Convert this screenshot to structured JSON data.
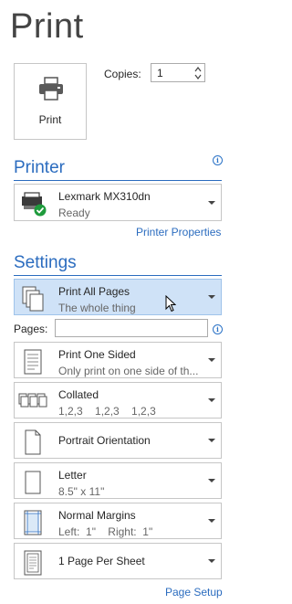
{
  "page": {
    "title": "Print"
  },
  "print_button": {
    "label": "Print",
    "icon": "printer-icon"
  },
  "copies": {
    "label": "Copies:",
    "value": "1"
  },
  "printer": {
    "heading": "Printer",
    "name": "Lexmark MX310dn",
    "status": "Ready",
    "properties_link": "Printer Properties",
    "info_symbol": "i"
  },
  "settings": {
    "heading": "Settings",
    "pages_label": "Pages:",
    "pages_value": "",
    "info_symbol": "i",
    "items": [
      {
        "title": "Print All Pages",
        "subtitle": "The whole thing",
        "icon": "pages-stack-icon"
      },
      {
        "title": "Print One Sided",
        "subtitle": "Only print on one side of th...",
        "icon": "one-sided-icon"
      },
      {
        "title": "Collated",
        "subtitle": "1,2,3    1,2,3    1,2,3",
        "icon": "collated-icon"
      },
      {
        "title": "Portrait Orientation",
        "subtitle": "",
        "icon": "portrait-icon"
      },
      {
        "title": "Letter",
        "subtitle": "8.5\" x 11\"",
        "icon": "paper-size-icon"
      },
      {
        "title": "Normal Margins",
        "subtitle": "Left:  1\"    Right:  1\"",
        "icon": "margins-icon"
      },
      {
        "title": "1 Page Per Sheet",
        "subtitle": "",
        "icon": "pages-per-sheet-icon"
      }
    ],
    "page_setup_link": "Page Setup"
  },
  "colors": {
    "accent": "#2b6cbf",
    "selected_bg": "#cfe2f7",
    "ready_green": "#1e9b3c"
  }
}
